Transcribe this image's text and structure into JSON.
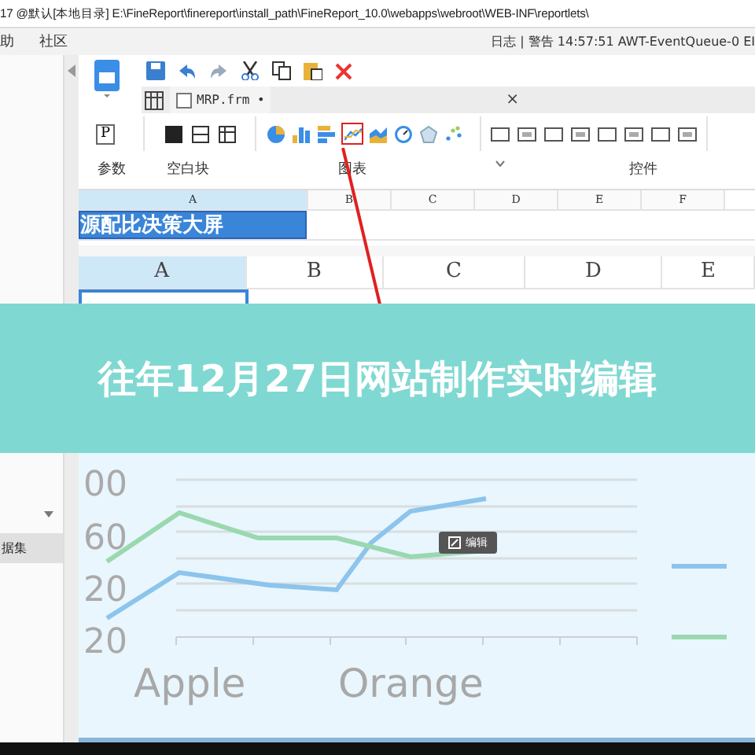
{
  "window": {
    "title": "17 @默认[本地目录]   E:\\FineReport\\finereport\\install_path\\FineReport_10.0\\webapps\\webroot\\WEB-INF\\reportlets\\"
  },
  "menu": {
    "items": [
      "助",
      "社区"
    ],
    "status": "日志 | 警告 14:57:51 AWT-EventQueue-0 EI"
  },
  "tab": {
    "label": "MRP.frm •",
    "close": "×"
  },
  "toolbar": {
    "param_key": "P",
    "groups": [
      "参数",
      "空白块",
      "图表",
      "控件"
    ],
    "chart_icons": [
      {
        "kind": "pie",
        "highlighted": false
      },
      {
        "kind": "bar",
        "highlighted": false
      },
      {
        "kind": "hbar",
        "highlighted": false
      },
      {
        "kind": "line",
        "highlighted": true
      },
      {
        "kind": "area",
        "highlighted": false
      },
      {
        "kind": "gauge",
        "highlighted": false
      },
      {
        "kind": "radar",
        "highlighted": false
      },
      {
        "kind": "scatter",
        "highlighted": false
      }
    ]
  },
  "sheet_small": {
    "columns": [
      {
        "label": "A",
        "selected": true
      },
      {
        "label": "B",
        "selected": false
      },
      {
        "label": "C",
        "selected": false
      },
      {
        "label": "D",
        "selected": false
      },
      {
        "label": "E",
        "selected": false
      },
      {
        "label": "F",
        "selected": false
      }
    ],
    "cell": "源配比决策大屏"
  },
  "sheet_large": {
    "columns": [
      {
        "label": "A",
        "selected": true
      },
      {
        "label": "B",
        "selected": false
      },
      {
        "label": "C",
        "selected": false
      },
      {
        "label": "D",
        "selected": false
      },
      {
        "label": "E",
        "selected": false
      }
    ]
  },
  "sidebar": {
    "items": [
      {
        "label": "据集",
        "selected": true
      }
    ]
  },
  "banner": {
    "title": "往年12月27日网站制作实时编辑"
  },
  "chart": {
    "y_labels": [
      "00",
      "60",
      "20",
      "20"
    ],
    "x_labels": [
      "Apple",
      "Orange"
    ],
    "edit_button": "编辑",
    "series": [
      {
        "color": "#8cc4ec"
      },
      {
        "color": "#9ad8b0"
      }
    ]
  }
}
